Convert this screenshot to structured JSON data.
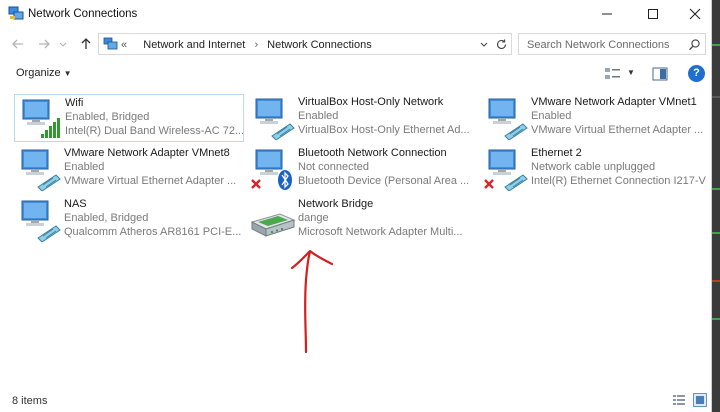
{
  "window": {
    "title": "Network Connections"
  },
  "address": {
    "overflow": "«",
    "crumbs": [
      "Network and Internet",
      "Network Connections"
    ]
  },
  "search": {
    "placeholder": "Search Network Connections"
  },
  "toolbar": {
    "organize_label": "Organize"
  },
  "help": {
    "label": "?"
  },
  "connections": [
    {
      "name": "Wifi",
      "status": "Enabled, Bridged",
      "device": "Intel(R) Dual Band Wireless-AC 72...",
      "icon": "wifi-adapter-icon",
      "selected": true
    },
    {
      "name": "VirtualBox Host-Only Network",
      "status": "Enabled",
      "device": "VirtualBox Host-Only Ethernet Ad...",
      "icon": "ethernet-adapter-icon"
    },
    {
      "name": "VMware Network Adapter VMnet1",
      "status": "Enabled",
      "device": "VMware Virtual Ethernet Adapter ...",
      "icon": "ethernet-adapter-icon"
    },
    {
      "name": "VMware Network Adapter VMnet8",
      "status": "Enabled",
      "device": "VMware Virtual Ethernet Adapter ...",
      "icon": "ethernet-adapter-icon"
    },
    {
      "name": "Bluetooth Network Connection",
      "status": "Not connected",
      "device": "Bluetooth Device (Personal Area ...",
      "icon": "bluetooth-adapter-icon"
    },
    {
      "name": "Ethernet 2",
      "status": "Network cable unplugged",
      "device": "Intel(R) Ethernet Connection I217-V",
      "icon": "ethernet-disconnected-icon"
    },
    {
      "name": "NAS",
      "status": "Enabled, Bridged",
      "device": "Qualcomm Atheros AR8161 PCI-E...",
      "icon": "ethernet-adapter-icon"
    },
    {
      "name": "Network Bridge",
      "status": "dange",
      "device": "Microsoft Network Adapter Multi...",
      "icon": "network-bridge-icon"
    }
  ],
  "status": {
    "item_count": "8 items"
  },
  "colors": {
    "accent": "#1e6fd0",
    "selection_border": "#bcd9f0",
    "error_red": "#d8242c",
    "annotation_red": "#d02020"
  }
}
